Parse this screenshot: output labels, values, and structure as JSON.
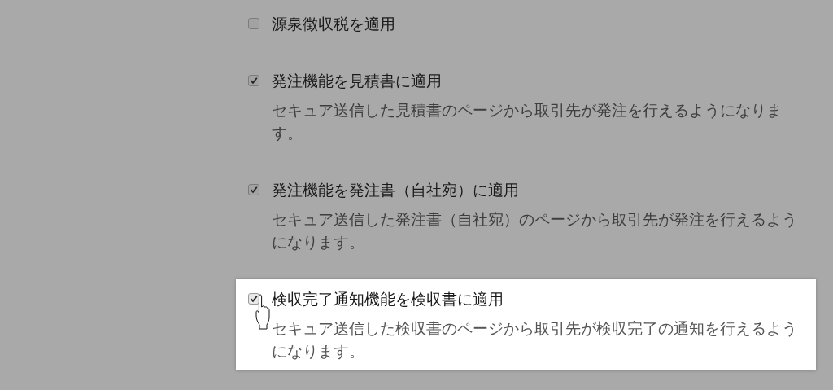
{
  "options": [
    {
      "label": "源泉徴収税を適用",
      "checked": false,
      "highlighted": false
    },
    {
      "label": "発注機能を見積書に適用",
      "checked": true,
      "highlighted": false,
      "description": "セキュア送信した見積書のページから取引先が発注を行えるようになります。"
    },
    {
      "label": "発注機能を発注書（自社宛）に適用",
      "checked": true,
      "highlighted": false,
      "description": "セキュア送信した発注書（自社宛）のページから取引先が発注を行えるようになります。"
    },
    {
      "label": "検収完了通知機能を検収書に適用",
      "checked": true,
      "highlighted": true,
      "description": "セキュア送信した検収書のページから取引先が検収完了の通知を行えるようになります。"
    }
  ]
}
